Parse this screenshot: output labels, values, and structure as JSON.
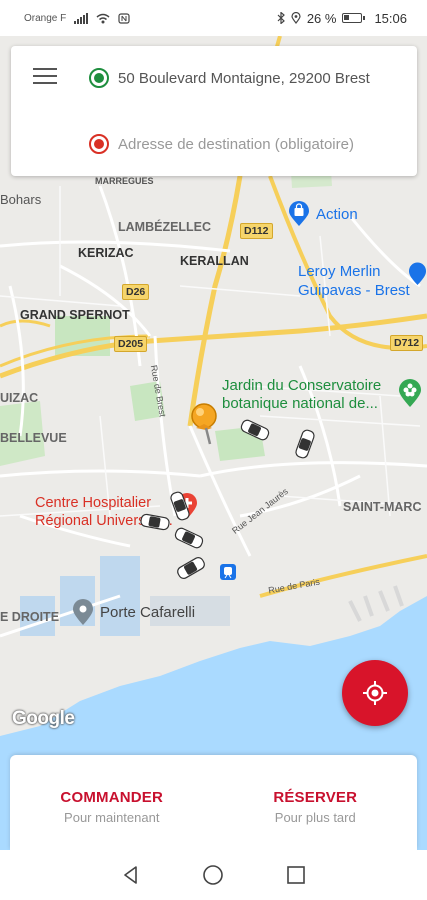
{
  "status_bar": {
    "carrier": "Orange F",
    "battery_percent": "26 %",
    "time": "15:06",
    "icons": [
      "signal-icon",
      "wifi-icon",
      "nfc-icon",
      "bluetooth-icon",
      "location-icon",
      "battery-icon"
    ]
  },
  "address_card": {
    "pickup_address": "50 Boulevard Montaigne, 29200 Brest",
    "destination_placeholder": "Adresse de destination (obligatoire)",
    "pickup_color": "#1e8e3e",
    "destination_color": "#d93025"
  },
  "map": {
    "labels": {
      "bohars": "Bohars",
      "marregues": "MARREGUES",
      "lambezellec": "LAMBÉZELLEC",
      "kerizac": "KERIZAC",
      "kerallan": "KERALLAN",
      "grand_spernot": "GRAND SPERNOT",
      "uizac": "UIZAC",
      "bellevue": "BELLEVUE",
      "saint_marc": "SAINT-MARC",
      "droite": "E DROITE",
      "rue_jean_jaures": "Rue Jean Jaurès",
      "rue_de_brest": "Rue de Brest",
      "rue_de_paris": "Rue de Paris"
    },
    "road_shields": {
      "d112": "D112",
      "d26": "D26",
      "d205": "D205",
      "d712": "D712"
    },
    "pois": {
      "action": "Action",
      "leroy_merlin": "Leroy Merlin\nGuipavas - Brest",
      "jardin": "Jardin du Conservatoire\nbotanique national de...",
      "hospital": "Centre Hospitalier\nRégional Universita...",
      "porte_cafarelli": "Porte Cafarelli"
    },
    "attribution": "Google",
    "accent_color": "#d8142a"
  },
  "actions": {
    "order": {
      "title": "COMMANDER",
      "subtitle": "Pour maintenant"
    },
    "book": {
      "title": "RÉSERVER",
      "subtitle": "Pour plus tard"
    }
  },
  "nav_bar": {
    "buttons": [
      "back-icon",
      "home-icon",
      "recents-icon"
    ]
  }
}
